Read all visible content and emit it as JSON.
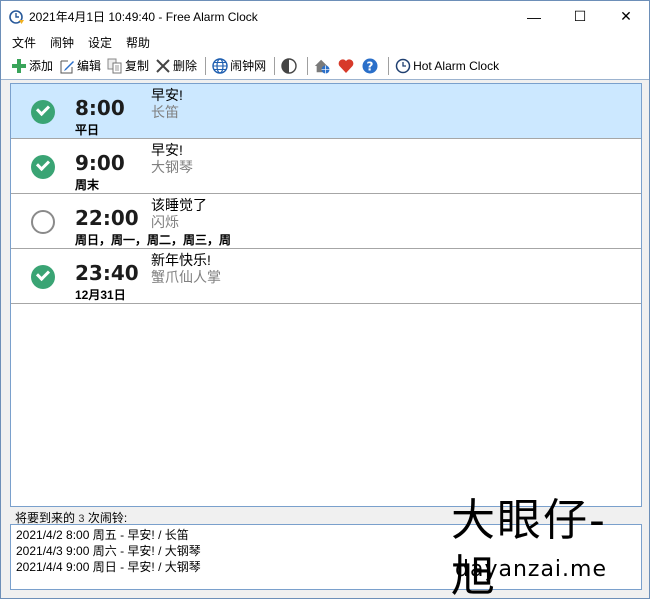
{
  "window": {
    "title": "2021年4月1日 10:49:40 - Free Alarm Clock",
    "controls": {
      "minimize": "—",
      "maximize": "☐",
      "close": "✕"
    }
  },
  "menu": {
    "items": [
      {
        "label": "文件"
      },
      {
        "label": "闹钟"
      },
      {
        "label": "设定"
      },
      {
        "label": "帮助"
      }
    ]
  },
  "toolbar": {
    "add": {
      "label": "添加",
      "icon": "plus-icon"
    },
    "edit": {
      "label": "编辑",
      "icon": "edit-icon"
    },
    "copy": {
      "label": "复制",
      "icon": "copy-icon"
    },
    "delete": {
      "label": "删除",
      "icon": "x-icon"
    },
    "web": {
      "label": "闹钟网",
      "icon": "globe-icon"
    },
    "theme": {
      "icon": "contrast-icon"
    },
    "home": {
      "icon": "home-globe-icon"
    },
    "like": {
      "icon": "heart-icon"
    },
    "help": {
      "icon": "help-icon"
    },
    "hot_alarm": {
      "label": "Hot Alarm Clock",
      "icon": "clock-icon"
    }
  },
  "alarms": [
    {
      "enabled": true,
      "time": "8:00",
      "days": "平日",
      "label": "早安!",
      "sound": "长笛",
      "selected": true
    },
    {
      "enabled": true,
      "time": "9:00",
      "days": "周末",
      "label": "早安!",
      "sound": "大钢琴",
      "selected": false
    },
    {
      "enabled": false,
      "time": "22:00",
      "days": "周日，周一，周二，周三，周",
      "label": "该睡觉了",
      "sound": "闪烁",
      "selected": false
    },
    {
      "enabled": true,
      "time": "23:40",
      "days": "12月31日",
      "label": "新年快乐!",
      "sound": "蟹爪仙人掌",
      "selected": false
    }
  ],
  "upcoming": {
    "label_prefix": "将要到来的",
    "count": "3",
    "label_suffix": "次闹铃:",
    "items": [
      "2021/4/2 8:00 周五 - 早安! / 长笛",
      "2021/4/3 9:00 周六 - 早安! / 大钢琴",
      "2021/4/4 9:00 周日 - 早安! / 大钢琴"
    ]
  },
  "watermark": {
    "text": "大眼仔-旭",
    "url": "dayanzai.me"
  },
  "colors": {
    "selected_row": "#cce8ff",
    "enabled_check": "#3aa474",
    "border_accent": "#7aa0cc"
  }
}
